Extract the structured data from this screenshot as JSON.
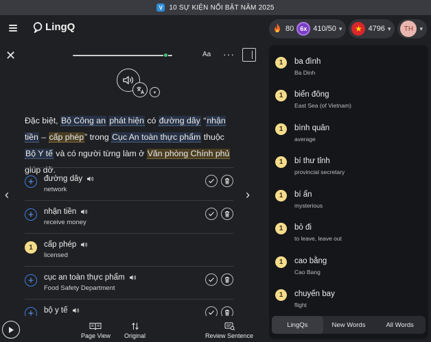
{
  "banner": {
    "text": "10 SỰ KIỆN NỔI BẬT NĂM 2025"
  },
  "header": {
    "logo": "LingQ",
    "streak": "80",
    "multiplier": "6x",
    "progress": "410/50",
    "coins": "4796",
    "avatar": "TH"
  },
  "toolbar": {
    "font_label": "Aa",
    "more_label": "···"
  },
  "passage": {
    "segments": [
      {
        "text": "Đặc biệt, ",
        "style": "plain"
      },
      {
        "text": "Bộ Công an",
        "style": "blue"
      },
      {
        "text": " ",
        "style": "plain"
      },
      {
        "text": "phát hiện",
        "style": "blue"
      },
      {
        "text": " có ",
        "style": "plain"
      },
      {
        "text": "đường dây",
        "style": "blue"
      },
      {
        "text": " “",
        "style": "plain"
      },
      {
        "text": "nhận tiền",
        "style": "blue"
      },
      {
        "text": " – ",
        "style": "plain"
      },
      {
        "text": "cấp phép",
        "style": "yellow"
      },
      {
        "text": "” trong ",
        "style": "plain"
      },
      {
        "text": "Cục An toàn thực phẩm",
        "style": "blue"
      },
      {
        "text": " thuộc ",
        "style": "plain"
      },
      {
        "text": "Bộ Y tế",
        "style": "blue"
      },
      {
        "text": " và có người từng làm ở ",
        "style": "plain"
      },
      {
        "text": "Văn phòng Chính phủ",
        "style": "yellow"
      },
      {
        "text": " giúp đỡ.",
        "style": "plain"
      }
    ]
  },
  "words": [
    {
      "term": "đường dây",
      "hint": "network",
      "status": "new",
      "level": "+"
    },
    {
      "term": "nhận tiền",
      "hint": "receive money",
      "status": "new",
      "level": "+"
    },
    {
      "term": "cấp phép",
      "hint": "licensed",
      "status": "lvl",
      "level": "1"
    },
    {
      "term": "cục an toàn thực phẩm",
      "hint": "Food Safety Department",
      "status": "new",
      "level": "+"
    },
    {
      "term": "bộ y tế",
      "hint": "",
      "status": "new",
      "level": "+"
    }
  ],
  "bottombar": {
    "page_view": "Page View",
    "original": "Original",
    "review": "Review Sentence"
  },
  "sidebar": {
    "items": [
      {
        "level": "1",
        "term": "ba đình",
        "hint": "Ba Dinh"
      },
      {
        "level": "1",
        "term": "biển đông",
        "hint": "East Sea (of Vietnam)"
      },
      {
        "level": "1",
        "term": "bình quân",
        "hint": "average"
      },
      {
        "level": "1",
        "term": "bí thư tỉnh",
        "hint": "provincial secretary"
      },
      {
        "level": "1",
        "term": "bí ẩn",
        "hint": "mysterious"
      },
      {
        "level": "1",
        "term": "bỏ đi",
        "hint": "to leave, leave out"
      },
      {
        "level": "1",
        "term": "cao bằng",
        "hint": "Cao Bang"
      },
      {
        "level": "1",
        "term": "chuyến bay",
        "hint": "flight"
      }
    ],
    "tabs": [
      {
        "label": "LingQs",
        "active": true
      },
      {
        "label": "New Words",
        "active": false
      },
      {
        "label": "All Words",
        "active": false
      }
    ]
  },
  "colors": {
    "background": "#1f2023",
    "accent_blue": "#3d7de0",
    "level_yellow": "#f5dc8a",
    "progress_green": "#40c47a"
  }
}
